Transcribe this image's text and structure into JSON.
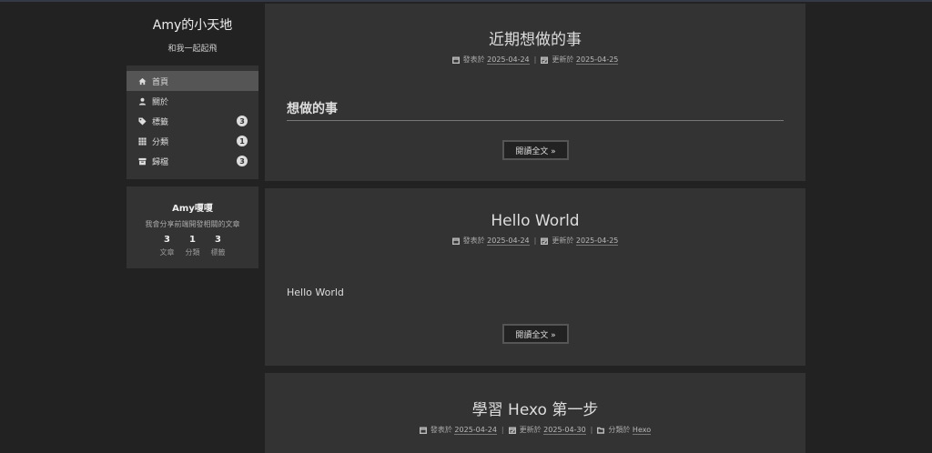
{
  "site": {
    "title": "Amy的小天地",
    "subtitle": "和我一起起飛"
  },
  "menu": [
    {
      "label": "首頁",
      "icon": "home-icon",
      "badge": ""
    },
    {
      "label": "關於",
      "icon": "user-icon",
      "badge": ""
    },
    {
      "label": "標籤",
      "icon": "tags-icon",
      "badge": "3"
    },
    {
      "label": "分類",
      "icon": "th-icon",
      "badge": "1"
    },
    {
      "label": "歸檔",
      "icon": "archive-icon",
      "badge": "3"
    }
  ],
  "author": {
    "name": "Amy嗄嗄",
    "description": "我會分享前端開發相關的文章",
    "stats": [
      {
        "num": "3",
        "label": "文章"
      },
      {
        "num": "1",
        "label": "分類"
      },
      {
        "num": "3",
        "label": "標籤"
      }
    ]
  },
  "posts": [
    {
      "title": "近期想做的事",
      "posted_label": "發表於",
      "posted_date": "2025-04-24",
      "updated_label": "更新於",
      "updated_date": "2025-04-25",
      "heading": "想做的事",
      "read_more": "閱讀全文 »"
    },
    {
      "title": "Hello World",
      "posted_label": "發表於",
      "posted_date": "2025-04-24",
      "updated_label": "更新於",
      "updated_date": "2025-04-25",
      "excerpt": "Hello World",
      "read_more": "閱讀全文 »"
    },
    {
      "title": "學習 Hexo 第一步",
      "posted_label": "發表於",
      "posted_date": "2025-04-24",
      "updated_label": "更新於",
      "updated_date": "2025-04-30",
      "category_label": "分類於",
      "category": "Hexo"
    }
  ],
  "meta_separator": "|"
}
